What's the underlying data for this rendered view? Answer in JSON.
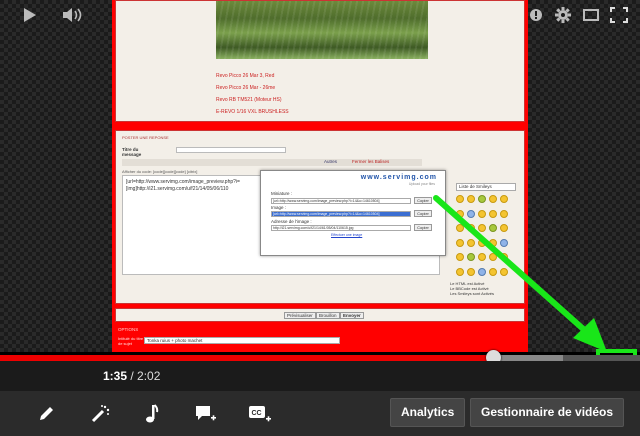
{
  "forum": {
    "signature_lines": [
      "Revo Picco 26 Mar 3, Red",
      "Revo Picco 26 Mar - 26me",
      "Revo RB TM521 (Moteur HS)",
      "E-REVO 1/16 VXL BRUSHLESS"
    ],
    "reply_header": "POSTER UNE REPONSE",
    "title_label": "Titre du message",
    "toolbar_auto": "Autres",
    "toolbar_close": "Fermer les Balises",
    "codes_label": "Afficher du code: [code][code][code] [citrix]",
    "editor_lines": [
      "[url=http://www.servimg.com/image_preview.php?i=",
      "[img]http://i21.servimg.com/u/f21/14/05/06/110"
    ],
    "smileys_select": "Liste de Smileys",
    "notes": [
      "Le HTML est Activé",
      "Le BBCode est Activé",
      "Les Smileys sont Activés"
    ],
    "buttons": [
      "Prévisualiser",
      "Brouillon",
      "Envoyer"
    ],
    "options_title": "OPTIONS",
    "options_label": "Intitulé du titre de sujet",
    "options_value": "Tonka ruius + photo machet"
  },
  "popup": {
    "logo": "www.servimg.com",
    "logo_sub": "Upload your files",
    "thumb_label": "Miniature :",
    "thumb_value": "[url=http://www.servimg.com/image_preview.php?i=14&u=14610504]",
    "image_label": "Image :",
    "image_value": "[url=http://www.servimg.com/image_preview.php?i=14&u=14610504]",
    "address_label": "Adresse de l'image :",
    "address_value": "http://i21.servimg.com/u/f21/14/61/05/04/110615.jpg",
    "copy": "Copier",
    "link": "Effectuer une image"
  },
  "player": {
    "current_time": "1:35",
    "separator": " / ",
    "duration": "2:02",
    "played_fraction": 0.77,
    "loaded_fraction": 0.88,
    "icons": [
      "play-icon",
      "volume-icon",
      "annotation-icon",
      "settings-icon",
      "theater-icon",
      "fullscreen-icon"
    ]
  },
  "editor_bar": {
    "analytics": "Analytics",
    "video_manager": "Gestionnaire de vidéos",
    "icons": [
      "pencil-icon",
      "magic-wand-icon",
      "music-note-icon",
      "add-annotation-icon",
      "add-captions-icon"
    ]
  },
  "colors": {
    "accent_green": "#19e619",
    "play_red": "#e00000",
    "forum_red": "#ff0000"
  }
}
